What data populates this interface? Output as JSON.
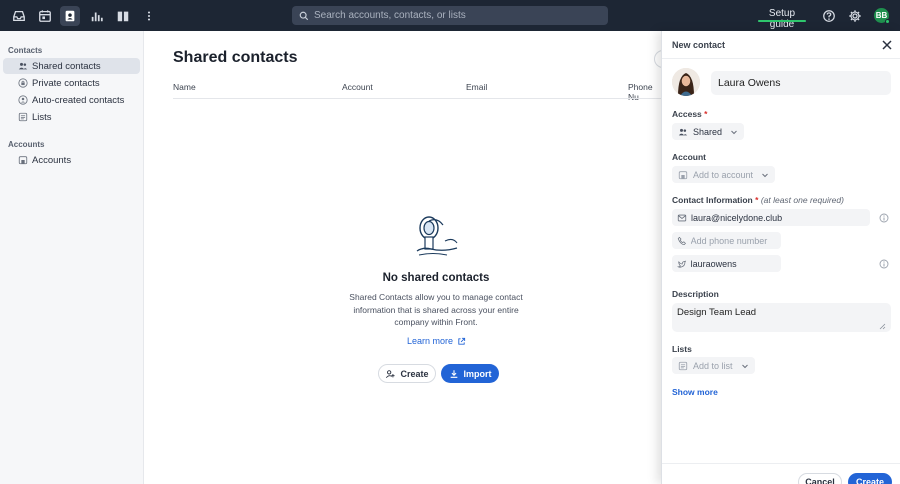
{
  "topbar": {
    "icons": [
      "inbox-icon",
      "calendar-icon",
      "contacts-icon",
      "analytics-icon",
      "knowledge-base-icon",
      "more-vertical-icon"
    ],
    "search_placeholder": "Search accounts, contacts, or lists",
    "setup_guide_label": "Setup guide",
    "setup_progress": 1.0,
    "avatar_initials": "BB"
  },
  "sidebar": {
    "contacts_section": "Contacts",
    "items": [
      {
        "label": "Shared contacts",
        "icon": "shared-users-icon",
        "active": true
      },
      {
        "label": "Private contacts",
        "icon": "lock-icon",
        "active": false
      },
      {
        "label": "Auto-created contacts",
        "icon": "auto-user-icon",
        "active": false
      },
      {
        "label": "Lists",
        "icon": "list-icon",
        "active": false
      }
    ],
    "accounts_section": "Accounts",
    "accounts_items": [
      {
        "label": "Accounts",
        "icon": "building-icon"
      }
    ]
  },
  "main": {
    "title": "Shared contacts",
    "columns": [
      "Name",
      "Account",
      "Email",
      "Phone Nu"
    ],
    "empty_title": "No shared contacts",
    "empty_desc": "Shared Contacts allow you to manage contact information that is shared across your entire company within Front.",
    "learn_more": "Learn more",
    "create_label": "Create",
    "import_label": "Import"
  },
  "panel": {
    "title": "New contact",
    "name_value": "Laura Owens",
    "access_label": "Access",
    "access_value": "Shared",
    "account_label": "Account",
    "account_placeholder": "Add to account",
    "contact_info_label": "Contact Information",
    "contact_info_hint": "(at least one required)",
    "email_value": "laura@nicelydone.club",
    "phone_placeholder": "Add phone number",
    "handle_value": "lauraowens",
    "description_label": "Description",
    "description_value": "Design Team Lead",
    "lists_label": "Lists",
    "lists_placeholder": "Add to list",
    "show_more": "Show more",
    "cancel_label": "Cancel",
    "create_label": "Create"
  },
  "colors": {
    "topbar_bg": "#1d2634",
    "accent_blue": "#2264d6",
    "progress_green": "#2ec66d",
    "avatar_green": "#1f8f4e",
    "required_red": "#d9302c"
  }
}
